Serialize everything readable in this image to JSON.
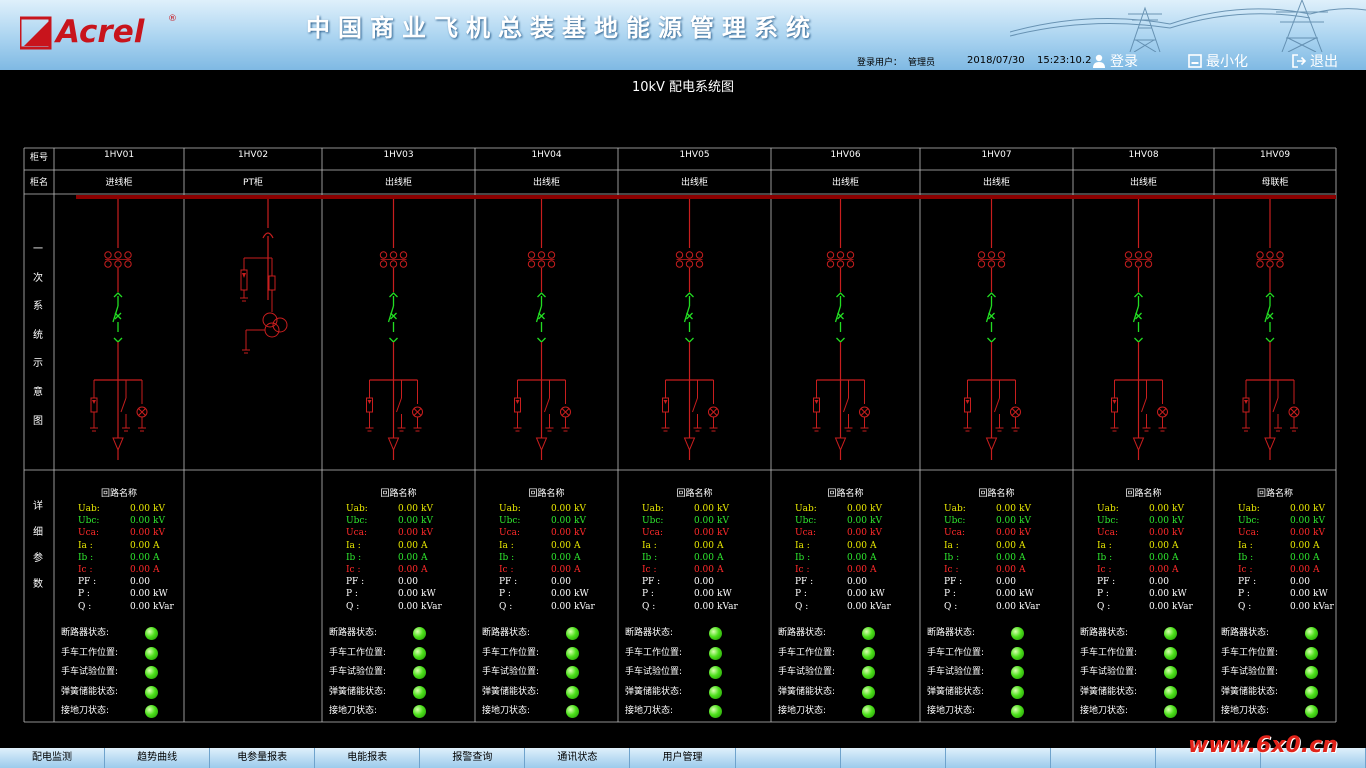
{
  "header": {
    "brand": "Acrel",
    "brand_reg": "®",
    "title": "中国商业飞机总装基地能源管理系统",
    "login_user_label": "登录用户：",
    "login_user": "管理员",
    "date": "2018/07/30",
    "time": "15:23:10.2",
    "login_btn": "登录",
    "minimize_btn": "最小化",
    "exit_btn": "退出"
  },
  "page_title": "10kV 配电系统图",
  "grid_labels": {
    "cabinet_no": "柜号",
    "cabinet_name": "柜名",
    "primary_diagram": [
      "一",
      "次",
      "系",
      "统",
      "示",
      "意",
      "图"
    ],
    "detail_params": [
      "详",
      "细",
      "参",
      "数"
    ]
  },
  "cabinets": [
    {
      "no": "1HV01",
      "name": "进线柜",
      "type": "feeder",
      "loop": "回路名称"
    },
    {
      "no": "1HV02",
      "name": "PT柜",
      "type": "pt",
      "loop": ""
    },
    {
      "no": "1HV03",
      "name": "出线柜",
      "type": "feeder",
      "loop": "回路名称"
    },
    {
      "no": "1HV04",
      "name": "出线柜",
      "type": "feeder",
      "loop": "回路名称"
    },
    {
      "no": "1HV05",
      "name": "出线柜",
      "type": "feeder",
      "loop": "回路名称"
    },
    {
      "no": "1HV06",
      "name": "出线柜",
      "type": "feeder",
      "loop": "回路名称"
    },
    {
      "no": "1HV07",
      "name": "出线柜",
      "type": "feeder",
      "loop": "回路名称"
    },
    {
      "no": "1HV08",
      "name": "出线柜",
      "type": "feeder",
      "loop": "回路名称"
    },
    {
      "no": "1HV09",
      "name": "母联柜",
      "type": "feeder",
      "loop": "回路名称"
    }
  ],
  "measurements": [
    {
      "key": "Uab:",
      "value": "0.00",
      "unit": "kV",
      "color": "#e8e800"
    },
    {
      "key": "Ubc:",
      "value": "0.00",
      "unit": "kV",
      "color": "#2ee62e"
    },
    {
      "key": "Uca:",
      "value": "0.00",
      "unit": "kV",
      "color": "#ff2a2a"
    },
    {
      "key": "Ia  :",
      "value": "0.00",
      "unit": "A",
      "color": "#e8e800"
    },
    {
      "key": "Ib  :",
      "value": "0.00",
      "unit": "A",
      "color": "#2ee62e"
    },
    {
      "key": "Ic  :",
      "value": "0.00",
      "unit": "A",
      "color": "#ff2a2a"
    },
    {
      "key": "PF  :",
      "value": "0.00",
      "unit": "",
      "color": "#ffffff"
    },
    {
      "key": "P    :",
      "value": "0.00",
      "unit": "kW",
      "color": "#ffffff"
    },
    {
      "key": "Q    :",
      "value": "0.00",
      "unit": "kVar",
      "color": "#ffffff"
    }
  ],
  "status_items": [
    "断路器状态:",
    "手车工作位置:",
    "手车试验位置:",
    "弹簧储能状态:",
    "接地刀状态:"
  ],
  "colors": {
    "busbar": "#8b0000",
    "circuit": "#c81e1e",
    "switch_green": "#22dd22",
    "led_on": "#4ce01a",
    "grid_line": "#bfbfbf"
  },
  "nav": [
    "配电监测",
    "趋势曲线",
    "电参量报表",
    "电能报表",
    "报警查询",
    "通讯状态",
    "用户管理",
    "",
    "",
    "",
    "",
    "",
    ""
  ],
  "watermark": "www.6x0.cn"
}
